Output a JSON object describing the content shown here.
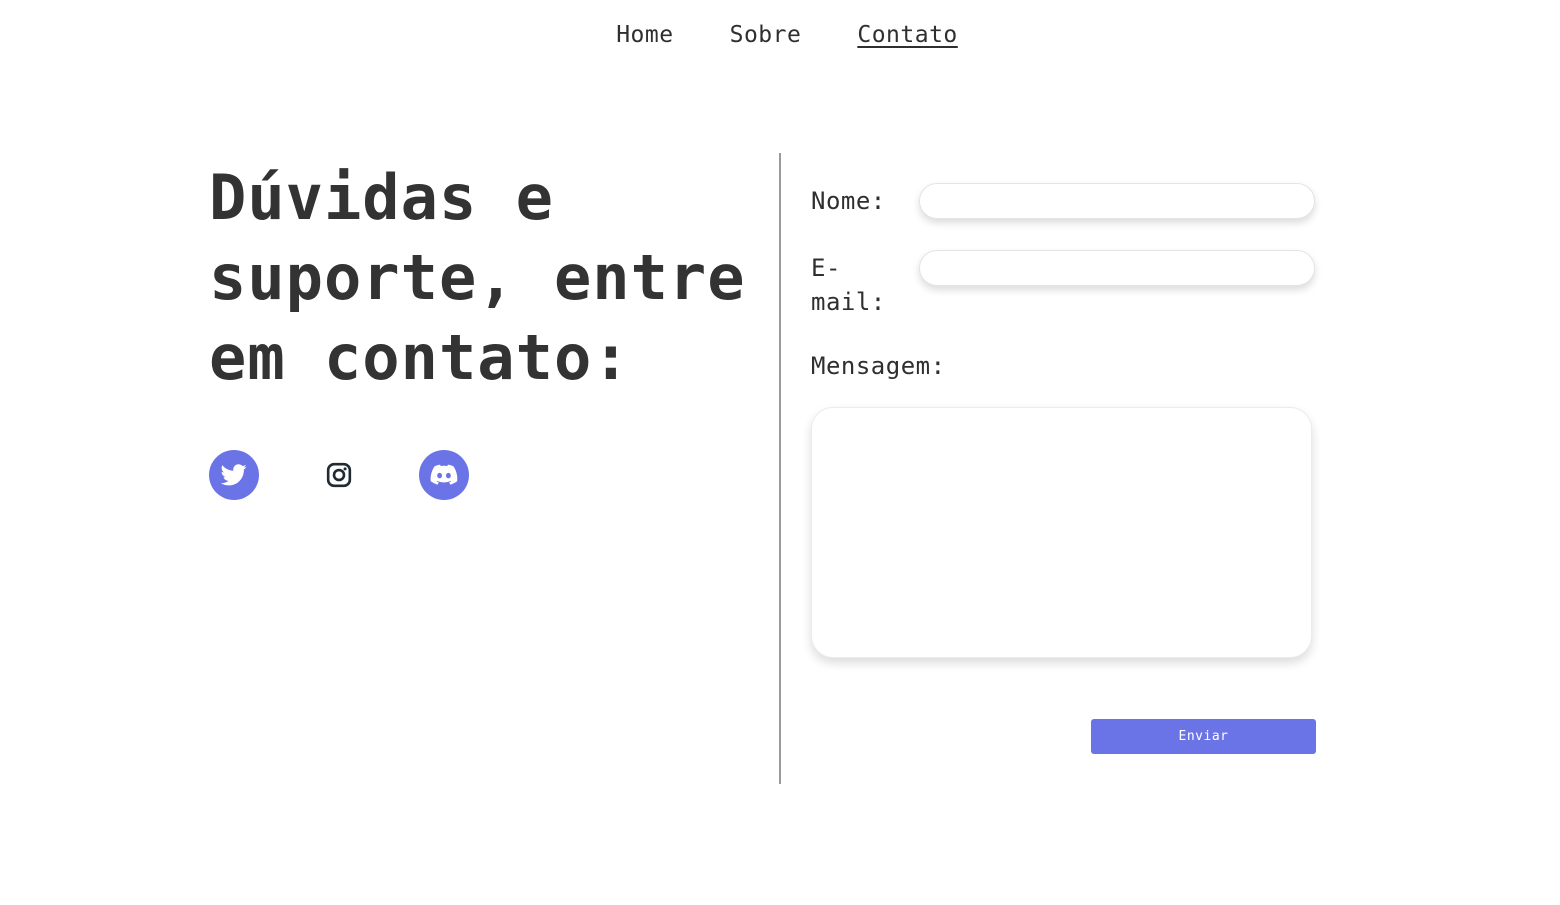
{
  "nav": {
    "items": [
      {
        "label": "Home"
      },
      {
        "label": "Sobre"
      },
      {
        "label": "Contato"
      }
    ]
  },
  "hero": {
    "title_lines": [
      "Dúvidas e",
      "suporte, entre",
      "em contato:"
    ]
  },
  "socials": [
    {
      "icon": "twitter-icon",
      "color": "#6b74e6"
    },
    {
      "icon": "instagram-icon",
      "color": "#1f1f1f"
    },
    {
      "icon": "discord-icon",
      "color": "#6b74e6"
    }
  ],
  "form": {
    "name_label": "Nome:",
    "email_label_line1": "E-",
    "email_label_line2": "mail:",
    "message_label": "Mensagem:",
    "name_value": "",
    "email_value": "",
    "message_value": "",
    "submit_label": "Enviar"
  },
  "colors": {
    "accent": "#6b74e6",
    "text": "#2f2f2f",
    "divider": "#9a9a9a"
  }
}
